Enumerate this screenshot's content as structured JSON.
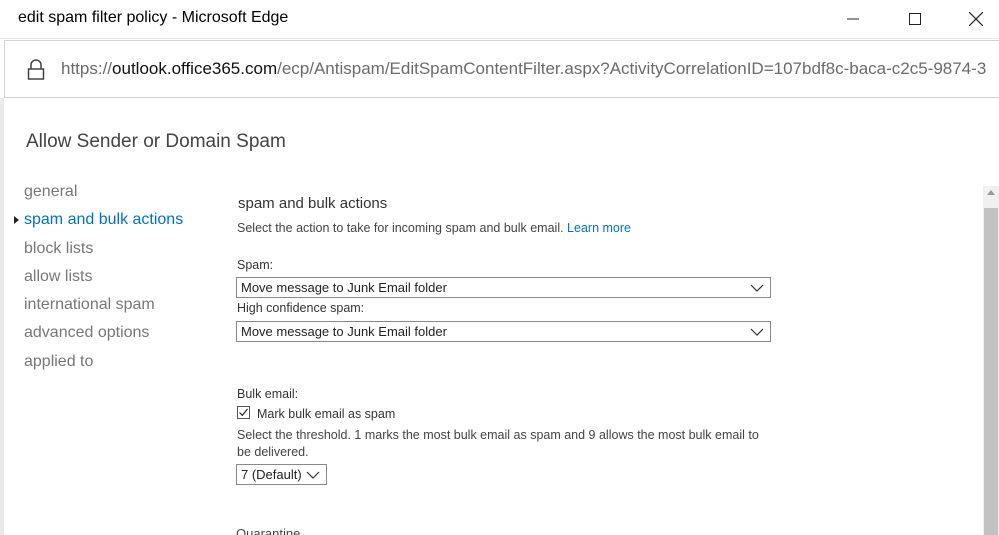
{
  "window": {
    "title": "edit spam filter policy - Microsoft Edge",
    "url_scheme": "https://",
    "url_host": "outlook.office365.com",
    "url_path": "/ecp/Antispam/EditSpamContentFilter.aspx?ActivityCorrelationID=107bdf8c-baca-c2c5-9874-3"
  },
  "page": {
    "title": "Allow Sender or Domain Spam"
  },
  "nav": {
    "items": [
      {
        "label": "general"
      },
      {
        "label": "spam and bulk actions"
      },
      {
        "label": "block lists"
      },
      {
        "label": "allow lists"
      },
      {
        "label": "international spam"
      },
      {
        "label": "advanced options"
      },
      {
        "label": "applied to"
      }
    ],
    "active_index": 1
  },
  "section": {
    "title": "spam and bulk actions",
    "description": "Select the action to take for incoming spam and bulk email.",
    "learn_more": "Learn more",
    "spam_label": "Spam:",
    "spam_value": "Move message to Junk Email folder",
    "high_conf_label": "High confidence spam:",
    "high_conf_value": "Move message to Junk Email folder",
    "bulk_label": "Bulk email:",
    "bulk_checkbox_label": "Mark bulk email as spam",
    "bulk_checked": true,
    "threshold_text": "Select the threshold. 1 marks the most bulk email as spam and 9 allows the most bulk email to be delivered.",
    "threshold_value": "7 (Default)",
    "next_heading_partial": "Quarantine"
  },
  "colors": {
    "accent": "#0072c6",
    "nav_text": "#777777"
  }
}
